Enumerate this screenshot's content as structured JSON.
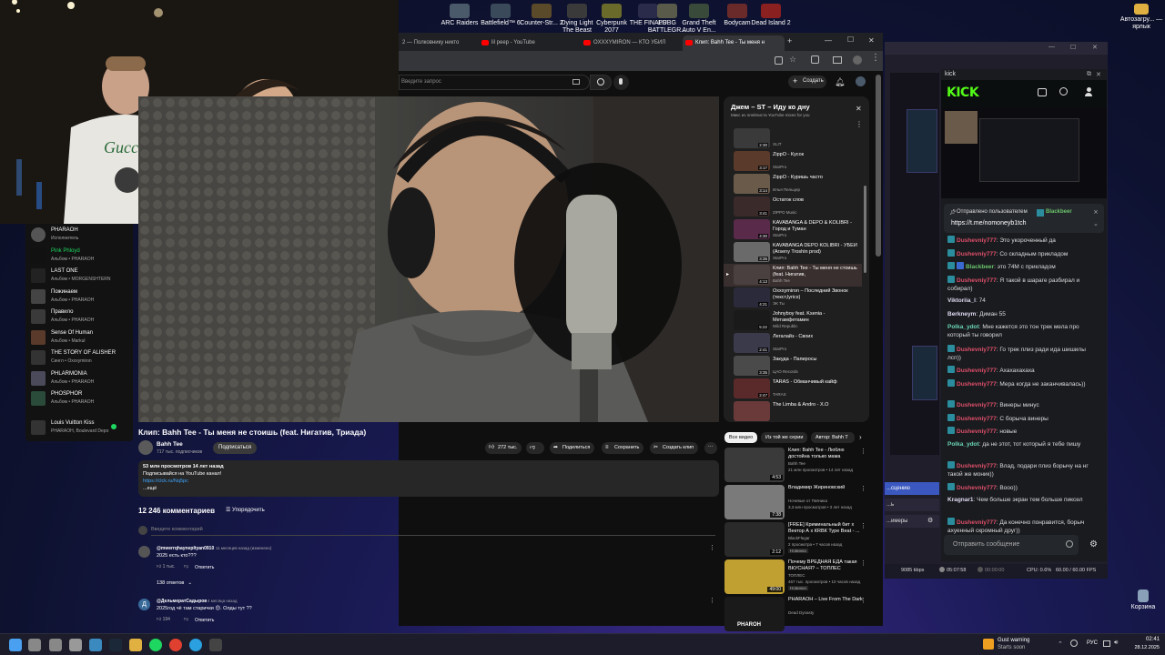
{
  "desktop": {
    "top_icons": [
      {
        "label": "ARC Raiders",
        "color": "#4a5a6a"
      },
      {
        "label": "Battlefield™ 6",
        "color": "#3a4a5a"
      },
      {
        "label": "Counter-Str... 2",
        "color": "#5a4a2a"
      },
      {
        "label": "Dying Light The Beast",
        "color": "#3a3a3a"
      },
      {
        "label": "Cyberpunk 2077",
        "color": "#6a6a2a"
      },
      {
        "label": "THE FINALS",
        "color": "#2a2a4a"
      },
      {
        "label": "PUBG BATTLEGR...",
        "color": "#5a5a4a"
      },
      {
        "label": "Grand Theft Auto V En...",
        "color": "#3a4a3a"
      },
      {
        "label": "Bodycam",
        "color": "#6a2a2a"
      },
      {
        "label": "Dead Island 2",
        "color": "#8a2020"
      }
    ],
    "right_icons": [
      {
        "label": "Автозагру... — ярлык"
      },
      {
        "label": "Корзина"
      }
    ]
  },
  "spotify": {
    "items": [
      {
        "title": "PHARAOH",
        "sub": "Исполнитель",
        "color": "#555",
        "verified": true
      },
      {
        "title": "Pink Phloyd",
        "sub": "Альбом • PHARAOH",
        "color": "#111",
        "title_color": "#1ed760"
      },
      {
        "title": "LAST ONE",
        "sub": "Альбом • MORGENSHTERN",
        "color": "#222"
      },
      {
        "title": "Пожинаем",
        "sub": "Альбом • PHARAOH",
        "color": "#444"
      },
      {
        "title": "Правило",
        "sub": "Альбом • PHARAOH",
        "color": "#3a3a3a"
      },
      {
        "title": "Sense Of Human",
        "sub": "Альбом • Markul",
        "color": "#5a3a2a"
      },
      {
        "title": "THE STORY OF ALISHER",
        "sub": "Сингл • Oxxxymiron",
        "color": "#333"
      },
      {
        "title": "PHLARMONIA",
        "sub": "Альбом • PHARAOH",
        "color": "#4a4a5a"
      },
      {
        "title": "PHOSPHOR",
        "sub": "Альбом • PHARAOH",
        "color": "#2a4a3a"
      }
    ],
    "now_playing": {
      "title": "Louis Vuitton Kiss",
      "artist": "PHARAOH, Boulevard Depo"
    }
  },
  "browser": {
    "tabs": [
      {
        "label": "2 — Полковнику никто",
        "active": false
      },
      {
        "label": "lil peep - YouTube",
        "active": false
      },
      {
        "label": "OXXXYMIRON — КТО УБИЛ",
        "active": false
      },
      {
        "label": "Клип: Bahh Tee - Ты меня н",
        "active": true
      }
    ],
    "window_controls": {
      "minimize": "—",
      "maximize": "☐",
      "close": "✕",
      "new_tab": "+"
    }
  },
  "youtube": {
    "search_placeholder": "Введите запрос",
    "create_label": "Создать",
    "video": {
      "title": "Клип: Bahh Tee - Ты меня не стоишь (feat. Нигатив, Триада)",
      "channel": "Bahh Tee",
      "subscribers": "717 тыс. подписчиков",
      "subscribe_label": "Подписаться",
      "likes": "272 тыс.",
      "share_label": "Поделиться",
      "save_label": "Сохранить",
      "clip_label": "Создать клип",
      "description": {
        "stats": "53 млн просмотров  14 лет назад",
        "line1": "Подписывайся на YouTube канал!",
        "link": "https://clck.ru/Nq5pc",
        "more": "...ещё"
      }
    },
    "comments": {
      "count": "12 246 комментариев",
      "sort_label": "Упорядочить",
      "add_placeholder": "Введите комментарий",
      "items": [
        {
          "author": "@mwerrqhaynepltyan0910",
          "time": "11 месяцев назад (изменено)",
          "text": "2025 есть кто???",
          "likes": "1 тыс.",
          "reply_label": "Ответить",
          "replies": "138 ответов",
          "avatar_color": "#555"
        },
        {
          "author": "@ДельмератСадыров",
          "time": "4 месяца назад",
          "text": "2025год чё там старички 😊. Олды тут ??",
          "likes": "194",
          "reply_label": "Ответить",
          "avatar_color": "#3a6a9a",
          "avatar_letter": "Д"
        }
      ]
    },
    "playlist": {
      "title": "Джем – ST – Иду ко дну",
      "subtitle": "Микс из плейлиста YouTube mixes for you",
      "items": [
        {
          "title": "",
          "channel": "XLIT",
          "dur": "2:30",
          "color": "#3a3a3a"
        },
        {
          "title": "ZippO - Кусок",
          "channel": "StarPro",
          "dur": "3:17",
          "color": "#5a3a2a"
        },
        {
          "title": "ZippO - Куришь часто",
          "channel": "Илья Пельцер",
          "dur": "3:14",
          "color": "#6a5a4a"
        },
        {
          "title": "Остаток слов",
          "channel": "ZIPPO Music",
          "dur": "3:41",
          "color": "#3a2a2a"
        },
        {
          "title": "KAVABANGA & DEPO & KOLIBRI - Город и Туман",
          "channel": "StarPro",
          "dur": "4:30",
          "color": "#5a2a4a"
        },
        {
          "title": "KAVABANGA DEPO KOLIBRI - УБЕЙ (Arseny Troshin prod)",
          "channel": "StarPro",
          "dur": "3:35",
          "color": "#6a6a6a"
        },
        {
          "title": "Клип: Bahh Tee - Ты меня не стоишь (feat. Нигатив,",
          "channel": "Bahh Tee",
          "dur": "4:13",
          "color": "#4a4040",
          "active": true
        },
        {
          "title": "Oxxxymiron – Последний Звонок (текст,lyrics)",
          "channel": "ЭК Ты",
          "dur": "4:21",
          "color": "#2a2a3a"
        },
        {
          "title": "Johnyboy feat. Ksenia - Метамфетамин",
          "channel": "Wild Republic",
          "dur": "5:22",
          "color": "#1a1a1a"
        },
        {
          "title": "Легалайз - Своих",
          "channel": "StarPro",
          "dur": "2:41",
          "color": "#3a3a4a"
        },
        {
          "title": "Закуда - Папиросы",
          "channel": "ЦАО Records",
          "dur": "3:35",
          "color": "#4a4a4a"
        },
        {
          "title": "TARAS - Обманчивый кайф",
          "channel": "TARAS",
          "dur": "2:47",
          "color": "#5a2a2a"
        },
        {
          "title": "The Limba & Andro - X.O",
          "channel": "",
          "dur": "",
          "color": "#6a3a3a"
        }
      ]
    },
    "filter_chips": [
      "Все видео",
      "Из той же серии",
      "Автор: Bahh T"
    ],
    "recommendations": [
      {
        "title": "Клип: Bahh Tee - Люблю достойна только мама",
        "channel": "Bahh Tee",
        "meta": "21 млн просмотров • 14 лет назад",
        "dur": "4:53",
        "color": "#3a3a3a"
      },
      {
        "title": "Владимир Жириновский",
        "channel": "Ночевые от Певчика",
        "meta": "3,3 млн просмотров • 3 лет назад",
        "dur": "7:38",
        "color": "#7a7a7a"
      },
      {
        "title": "[FREE] Криминальный бит x Вектор А x КRВК Type Beat - ...",
        "channel": "BlackFlegar",
        "meta": "2 просмотра • 7 часов назад",
        "badge": "Новинка",
        "dur": "2:12",
        "color": "#2a2a2a"
      },
      {
        "title": "Почему ВРЕДНАЯ ЕДА такая ВКУСНАЯ? – ТОПЛЕС",
        "channel": "ТОПЛЕС",
        "meta": "467 тыс. просмотров • 10 часов назад",
        "badge": "Новинка",
        "dur": "49:00",
        "color": "#c0a030"
      },
      {
        "title": "PHARAOH – Live From The Dark",
        "channel": "Dead Dynasty",
        "meta": "",
        "dur": "",
        "color": "#1a1a1a",
        "thumb_text": "PHAROH"
      }
    ]
  },
  "obs": {
    "bitrate": "9085 kbps",
    "time_live": "05:07:58",
    "time_rec": "00:00:00",
    "cpu": "CPU: 0.6%",
    "fps": "60.00 / 60.00 FPS",
    "buttons": [
      "...сцению",
      "...ь",
      "...имеры"
    ]
  },
  "kick": {
    "window_title": "kick",
    "logo": "KICK",
    "pinned": {
      "sender": "Отправлено пользователем",
      "name": "Blackbeer",
      "text": "https://t.me/nomoneyb1tch"
    },
    "messages": [
      {
        "user": "Dushevniy777",
        "user_color": "#e0506a",
        "badge": true,
        "text": "Это укороченный да"
      },
      {
        "user": "Dushevniy777",
        "user_color": "#e0506a",
        "badge": true,
        "text": "Со складным прикладом"
      },
      {
        "user": "Blackbeer",
        "user_color": "#6bc46b",
        "badge": true,
        "badge2": true,
        "text": "это 74М с прикладом"
      },
      {
        "user": "Dushevniy777",
        "user_color": "#e0506a",
        "badge": true,
        "text": "Я такой в шараге разбирал и собирал)"
      },
      {
        "user": "Viktoriia_l",
        "user_color": "#e0d9f0",
        "badge": false,
        "text": "74"
      },
      {
        "user": "Berkneym",
        "user_color": "#e0d9f0",
        "badge": false,
        "text": "Диман 55"
      },
      {
        "user": "Polka_ydot",
        "user_color": "#6bd4b4",
        "badge": false,
        "text": "Мне кажется это тон трек мела про который ты говорил"
      },
      {
        "user": "Dushevniy777",
        "user_color": "#e0506a",
        "badge": true,
        "text": "Го трек плиз ради ида шишилы лсп))"
      },
      {
        "user": "Dushevniy777",
        "user_color": "#e0506a",
        "badge": true,
        "text": "Ахахахахаха"
      },
      {
        "user": "Dushevniy777",
        "user_color": "#e0506a",
        "badge": true,
        "text": "Мера когда не заканчивалась))"
      },
      {
        "user": "Dushevniy777",
        "user_color": "#e0506a",
        "badge": true,
        "text": "Винеры минус"
      },
      {
        "user": "Dushevniy777",
        "user_color": "#e0506a",
        "badge": true,
        "text": "С борыча винеры"
      },
      {
        "user": "Dushevniy777",
        "user_color": "#e0506a",
        "badge": true,
        "text": "новые"
      },
      {
        "user": "Polka_ydot",
        "user_color": "#6bd4b4",
        "badge": false,
        "text": "да не этот, тот который я тебе пишу"
      },
      {
        "user": "Dushevniy777",
        "user_color": "#e0506a",
        "badge": true,
        "text": "Влад, подари плиз борычу на нг такой же моник))"
      },
      {
        "user": "Dushevniy777",
        "user_color": "#e0506a",
        "badge": true,
        "text": "Вооо))"
      },
      {
        "user": "Kragnar1",
        "user_color": "#e0d9f0",
        "badge": false,
        "text": "Чем больше экран тем больше пиксел"
      },
      {
        "user": "Dushevniy777",
        "user_color": "#e0506a",
        "badge": true,
        "text": "Да конечно понравится, борыч ахуенный скромный друг))"
      }
    ],
    "input_placeholder": "Отправить сообщение"
  },
  "taskbar": {
    "notification": {
      "title": "Gust warning",
      "sub": "Starts soon"
    },
    "lang": "РУС",
    "time": "02:41",
    "date": "28.12.2025",
    "icons": [
      {
        "name": "start-icon",
        "color": "#4aa0f0"
      },
      {
        "name": "search-icon",
        "color": "#888"
      },
      {
        "name": "task-view-icon",
        "color": "#888"
      },
      {
        "name": "settings-icon",
        "color": "#999"
      },
      {
        "name": "gallery-icon",
        "color": "#3a8ac0"
      },
      {
        "name": "steam-icon",
        "color": "#1b2838"
      },
      {
        "name": "folder-icon",
        "color": "#e0b040"
      },
      {
        "name": "spotify-icon",
        "color": "#1ed760"
      },
      {
        "name": "chrome-icon",
        "color": "#e04030"
      },
      {
        "name": "telegram-icon",
        "color": "#2aa0e0"
      },
      {
        "name": "obs-icon",
        "color": "#444"
      }
    ]
  }
}
